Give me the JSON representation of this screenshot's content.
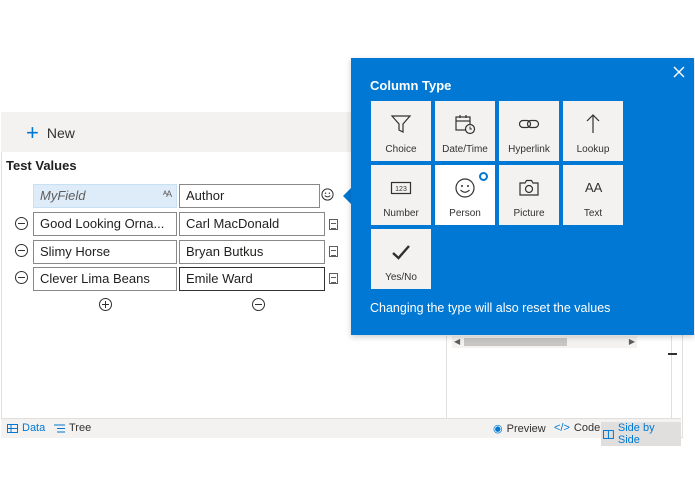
{
  "toolbar": {
    "new_label": "New"
  },
  "section": {
    "title": "Test Values"
  },
  "grid": {
    "header": {
      "field": "MyField",
      "type_glyph": "ᴬA",
      "value": "Author"
    },
    "rows": [
      {
        "name": "Good Looking Orna...",
        "value": "Carl MacDonald"
      },
      {
        "name": "Slimy Horse",
        "value": "Bryan Butkus"
      },
      {
        "name": "Clever Lima Beans",
        "value": "Emile Ward"
      }
    ]
  },
  "bottom_bar": {
    "data_label": "Data",
    "tree_label": "Tree",
    "preview_label": "Preview",
    "code_label": "Code",
    "side_label": "Side by Side"
  },
  "popup": {
    "title": "Column Type",
    "note": "Changing the type will also reset the values",
    "selected": "Person",
    "types": [
      {
        "label": "Choice",
        "icon": "filter-icon"
      },
      {
        "label": "Date/Time",
        "icon": "calendar-clock-icon"
      },
      {
        "label": "Hyperlink",
        "icon": "link-icon"
      },
      {
        "label": "Lookup",
        "icon": "arrow-up-icon"
      },
      {
        "label": "Number",
        "icon": "number-icon",
        "glyph": "123"
      },
      {
        "label": "Person",
        "icon": "smiley-icon"
      },
      {
        "label": "Picture",
        "icon": "camera-icon"
      },
      {
        "label": "Text",
        "icon": "text-size-icon",
        "glyph": "AA"
      },
      {
        "label": "Yes/No",
        "icon": "checkmark-icon"
      }
    ]
  },
  "colors": {
    "accent": "#0078d4",
    "tile": "#f3f2f1",
    "header_cell": "#deecf9"
  }
}
